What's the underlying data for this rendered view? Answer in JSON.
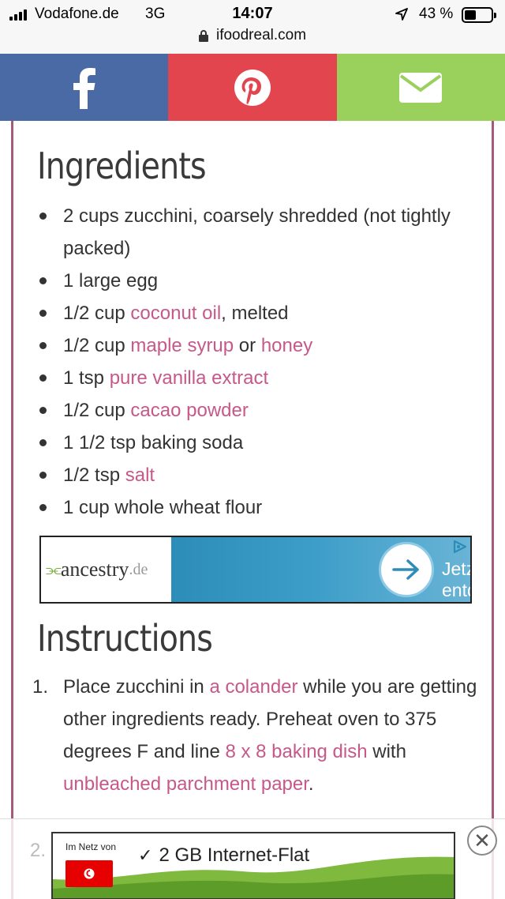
{
  "status_bar": {
    "carrier": "Vodafone.de",
    "network": "3G",
    "time": "14:07",
    "battery_percent": "43 %",
    "battery_level": 0.43
  },
  "url_bar": {
    "domain": "ifoodreal.com"
  },
  "share_bar": {
    "icons": [
      "facebook-icon",
      "pinterest-icon",
      "mail-icon"
    ],
    "colors": {
      "facebook": "#4a6aa5",
      "pinterest": "#e3454f",
      "mail": "#9ad05c"
    }
  },
  "ingredients": {
    "title": "Ingredients",
    "items": [
      {
        "text": "2 cups zucchini, coarsely shredded (not tightly packed)"
      },
      {
        "text": "1 large egg"
      },
      {
        "pre": "1/2 cup ",
        "link": "coconut oil",
        "post": ", melted"
      },
      {
        "pre": "1/2 cup ",
        "link": "maple syrup",
        "mid": " or ",
        "link2": "honey"
      },
      {
        "pre": "1 tsp ",
        "link": "pure vanilla extract"
      },
      {
        "pre": "1/2 cup ",
        "link": "cacao powder"
      },
      {
        "text": "1 1/2 tsp baking soda"
      },
      {
        "pre": "1/2 tsp ",
        "link": "salt"
      },
      {
        "text": "1 cup whole wheat flour"
      }
    ]
  },
  "ad": {
    "brand": "ancestry",
    "brand_tld": ".de",
    "cta": "Jetzt entdecken"
  },
  "instructions": {
    "title": "Instructions",
    "step1": {
      "number": "1.",
      "t1": "Place zucchini in ",
      "l1": "a colander",
      "t2": " while you are getting other ingredients ready. Preheat oven to 375 degrees F and line ",
      "l2": "8 x 8 baking dish",
      "t3": " with ",
      "l3": "unbleached parchment paper",
      "t4": "."
    },
    "step2_number": "2."
  },
  "bottom_ad": {
    "small_text": "Im Netz von",
    "headline": "2 GB Internet-Flat",
    "logo_word": "vodafone"
  },
  "accent_color": "#c7588a"
}
